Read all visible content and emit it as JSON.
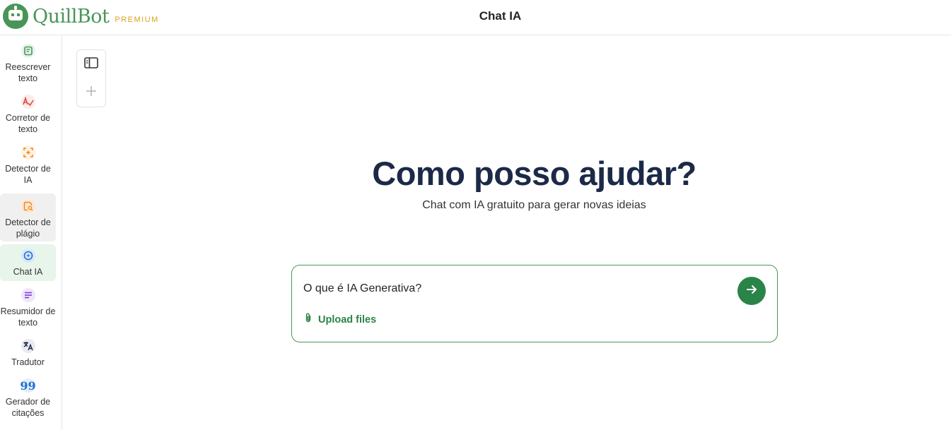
{
  "header": {
    "brand": "QuillBot",
    "badge": "PREMIUM",
    "title": "Chat IA"
  },
  "sidebar": {
    "items": [
      {
        "label": "Reescrever texto",
        "icon": "rewrite-icon",
        "color": "#499557",
        "bg": "#e8f4eb"
      },
      {
        "label": "Corretor de texto",
        "icon": "grammar-check-icon",
        "color": "#e04a3f",
        "bg": "#fdecea"
      },
      {
        "label": "Detector de IA",
        "icon": "ai-detector-icon",
        "color": "#f08a1c",
        "bg": "#fff1e2"
      },
      {
        "label": "Detector de plágio",
        "icon": "plagiarism-icon",
        "color": "#f08a1c",
        "bg": "#fde7d6"
      },
      {
        "label": "Chat IA",
        "icon": "ai-chat-icon",
        "color": "#1f6fd1",
        "bg": "#d9e8fb"
      },
      {
        "label": "Resumidor de texto",
        "icon": "summarizer-icon",
        "color": "#7b3fd0",
        "bg": "#efe6fb"
      },
      {
        "label": "Tradutor",
        "icon": "translate-icon",
        "color": "#1c2a48",
        "bg": "#e9ebf0"
      },
      {
        "label": "Gerador de citações",
        "icon": "citation-icon",
        "color": "#1f6fd1",
        "bg": "#e3eefc"
      }
    ],
    "active_index": 4,
    "hover_index": 3
  },
  "toolbar": {
    "toggle_icon": "sidebar-toggle-icon",
    "new_chat_icon": "plus-icon"
  },
  "main": {
    "heading": "Como posso ajudar?",
    "subheading": "Chat com IA gratuito para gerar novas ideias",
    "input_placeholder": "O que é IA Generativa?",
    "upload_label": "Upload files",
    "send_icon": "arrow-right-icon",
    "accent": "#2a8447"
  }
}
